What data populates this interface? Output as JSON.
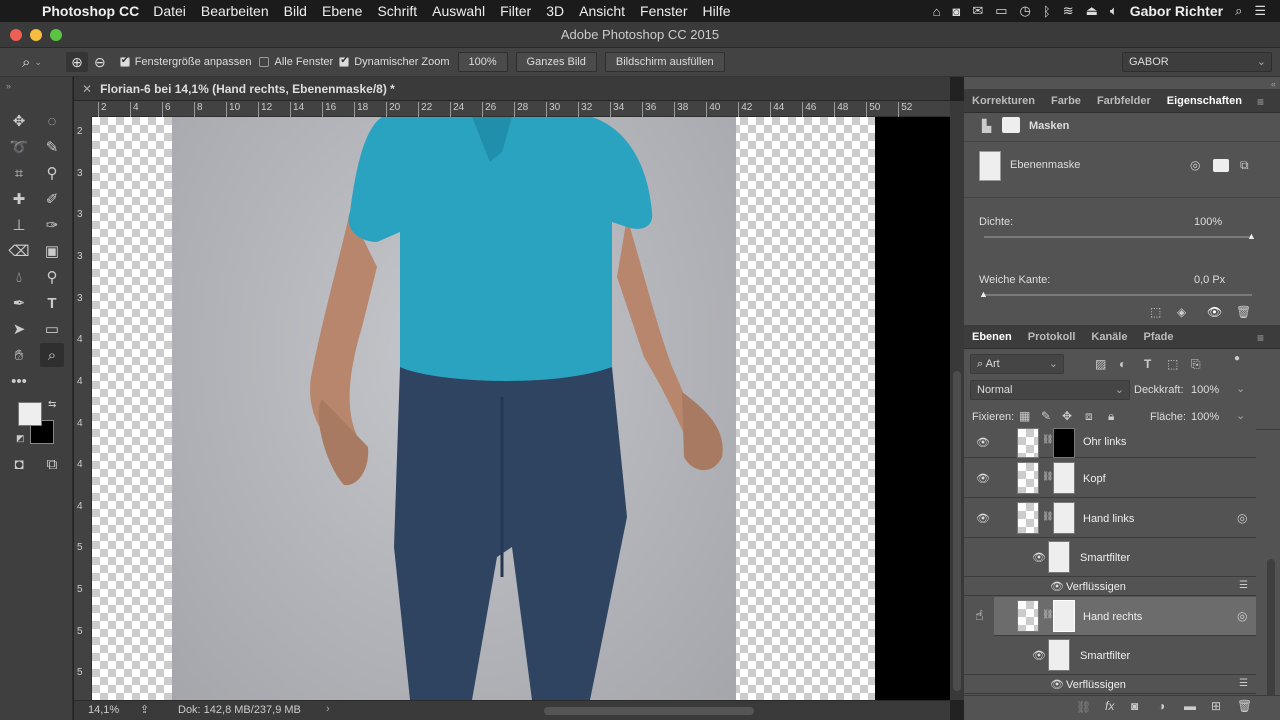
{
  "menubar": {
    "app_name": "Photoshop CC",
    "items": [
      "Datei",
      "Bearbeiten",
      "Bild",
      "Ebene",
      "Schrift",
      "Auswahl",
      "Filter",
      "3D",
      "Ansicht",
      "Fenster",
      "Hilfe"
    ],
    "user": "Gabor Richter"
  },
  "window": {
    "title": "Adobe Photoshop CC 2015"
  },
  "options": {
    "fit_window_label": "Fenstergröße anpassen",
    "all_windows_label": "Alle Fenster",
    "dynamic_zoom_label": "Dynamischer Zoom",
    "zoom_value": "100%",
    "whole_image_label": "Ganzes Bild",
    "fill_screen_label": "Bildschirm ausfüllen",
    "workspace": "GABOR"
  },
  "document": {
    "tab_title": "Florian-6 bei 14,1% (Hand rechts, Ebenenmaske/8) *",
    "ruler_h_ticks": [
      "2",
      "4",
      "6",
      "8",
      "10",
      "12",
      "14",
      "16",
      "18",
      "20",
      "22",
      "24",
      "26",
      "28",
      "30",
      "32",
      "34",
      "36",
      "38",
      "40",
      "42",
      "44",
      "46",
      "48",
      "50",
      "52"
    ],
    "ruler_v_ticks": [
      "2",
      "3",
      "3",
      "3",
      "3",
      "4",
      "4",
      "4",
      "4",
      "4",
      "5",
      "5",
      "5",
      "5"
    ],
    "status_zoom": "14,1%",
    "status_doc": "Dok: 142,8 MB/237,9 MB"
  },
  "properties": {
    "tabs": [
      "Korrekturen",
      "Farbe",
      "Farbfelder",
      "Eigenschaften"
    ],
    "active_tab": "Eigenschaften",
    "masks_title": "Masken",
    "layer_mask_label": "Ebenenmaske",
    "density_label": "Dichte:",
    "density_value": "100%",
    "density": 1.0,
    "feather_label": "Weiche Kante:",
    "feather_value": "0,0 Px"
  },
  "layers_panel": {
    "tabs": [
      "Ebenen",
      "Protokoll",
      "Kanäle",
      "Pfade"
    ],
    "active_tab": "Ebenen",
    "filter_kind": "Art",
    "blend_mode": "Normal",
    "opacity_label": "Deckkraft:",
    "opacity_value": "100%",
    "lock_label": "Fixieren:",
    "fill_label": "Fläche:",
    "fill_value": "100%",
    "layers": [
      {
        "name": "Ohr links"
      },
      {
        "name": "Kopf"
      },
      {
        "name": "Hand links"
      },
      {
        "name": "Smartfilter"
      },
      {
        "name": "Verflüssigen"
      },
      {
        "name": "Hand rechts"
      },
      {
        "name": "Smartfilter"
      },
      {
        "name": "Verflüssigen"
      }
    ]
  },
  "colors": {
    "accent_shirt": "#2aa3c1",
    "panel_bg": "#535353",
    "selected_layer": "#6c6c6c"
  }
}
